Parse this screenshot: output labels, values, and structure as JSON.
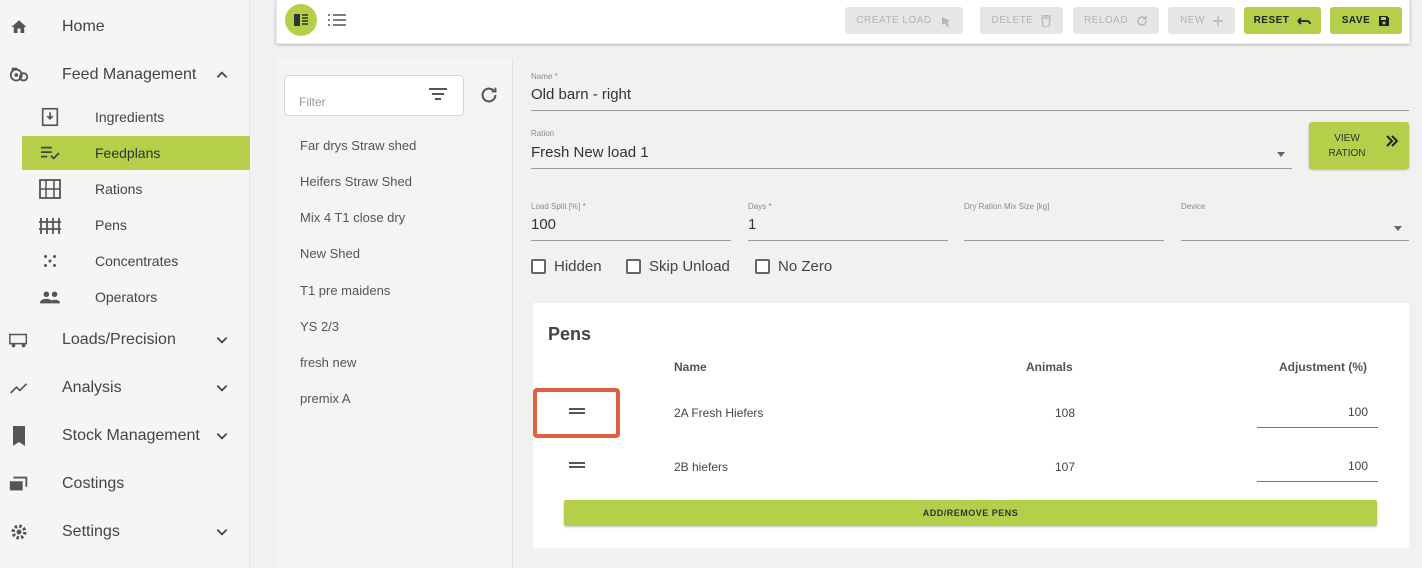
{
  "sidebar": {
    "items": [
      {
        "label": "Home",
        "icon": "home-icon"
      },
      {
        "label": "Feed Management",
        "icon": "feed-management-icon",
        "expanded": true
      },
      {
        "label": "Loads/Precision",
        "icon": "loads-icon"
      },
      {
        "label": "Analysis",
        "icon": "analysis-icon"
      },
      {
        "label": "Stock Management",
        "icon": "stock-icon"
      },
      {
        "label": "Costings",
        "icon": "costings-icon"
      },
      {
        "label": "Settings",
        "icon": "settings-icon"
      }
    ],
    "subitems": [
      {
        "label": "Ingredients",
        "icon": "ingredients-icon"
      },
      {
        "label": "Feedplans",
        "icon": "feedplans-icon",
        "active": true
      },
      {
        "label": "Rations",
        "icon": "rations-icon"
      },
      {
        "label": "Pens",
        "icon": "pens-icon"
      },
      {
        "label": "Concentrates",
        "icon": "concentrates-icon"
      },
      {
        "label": "Operators",
        "icon": "operators-icon"
      }
    ]
  },
  "toolbar": {
    "create_load": "CREATE LOAD",
    "delete": "DELETE",
    "reload": "RELOAD",
    "new": "NEW",
    "reset": "RESET",
    "save": "SAVE"
  },
  "list": {
    "filter_placeholder": "Filter",
    "items": [
      "Far drys Straw shed",
      "Heifers Straw Shed",
      "Mix 4 T1 close dry",
      "New Shed",
      "T1 pre maidens",
      "YS 2/3",
      "fresh new",
      "premix A"
    ]
  },
  "form": {
    "name_label": "Name *",
    "name_value": "Old barn - right",
    "ration_label": "Ration",
    "ration_value": "Fresh New load 1",
    "view_ration": "VIEW RATION",
    "load_split_label": "Load Split [%] *",
    "load_split_value": "100",
    "days_label": "Days *",
    "days_value": "1",
    "dry_ration_label": "Dry Ration Mix Size [kg]",
    "dry_ration_value": "",
    "device_label": "Device",
    "device_value": "",
    "hidden_label": "Hidden",
    "skip_unload_label": "Skip Unload",
    "no_zero_label": "No Zero"
  },
  "pens": {
    "title": "Pens",
    "col_name": "Name",
    "col_animals": "Animals",
    "col_adjustment": "Adjustment (%)",
    "rows": [
      {
        "name": "2A Fresh Hiefers",
        "animals": "108",
        "adjustment": "100"
      },
      {
        "name": "2B hiefers",
        "animals": "107",
        "adjustment": "100"
      }
    ],
    "add_remove": "ADD/REMOVE PENS"
  },
  "colors": {
    "accent": "#b5cf4a",
    "highlight": "#e0603f"
  }
}
